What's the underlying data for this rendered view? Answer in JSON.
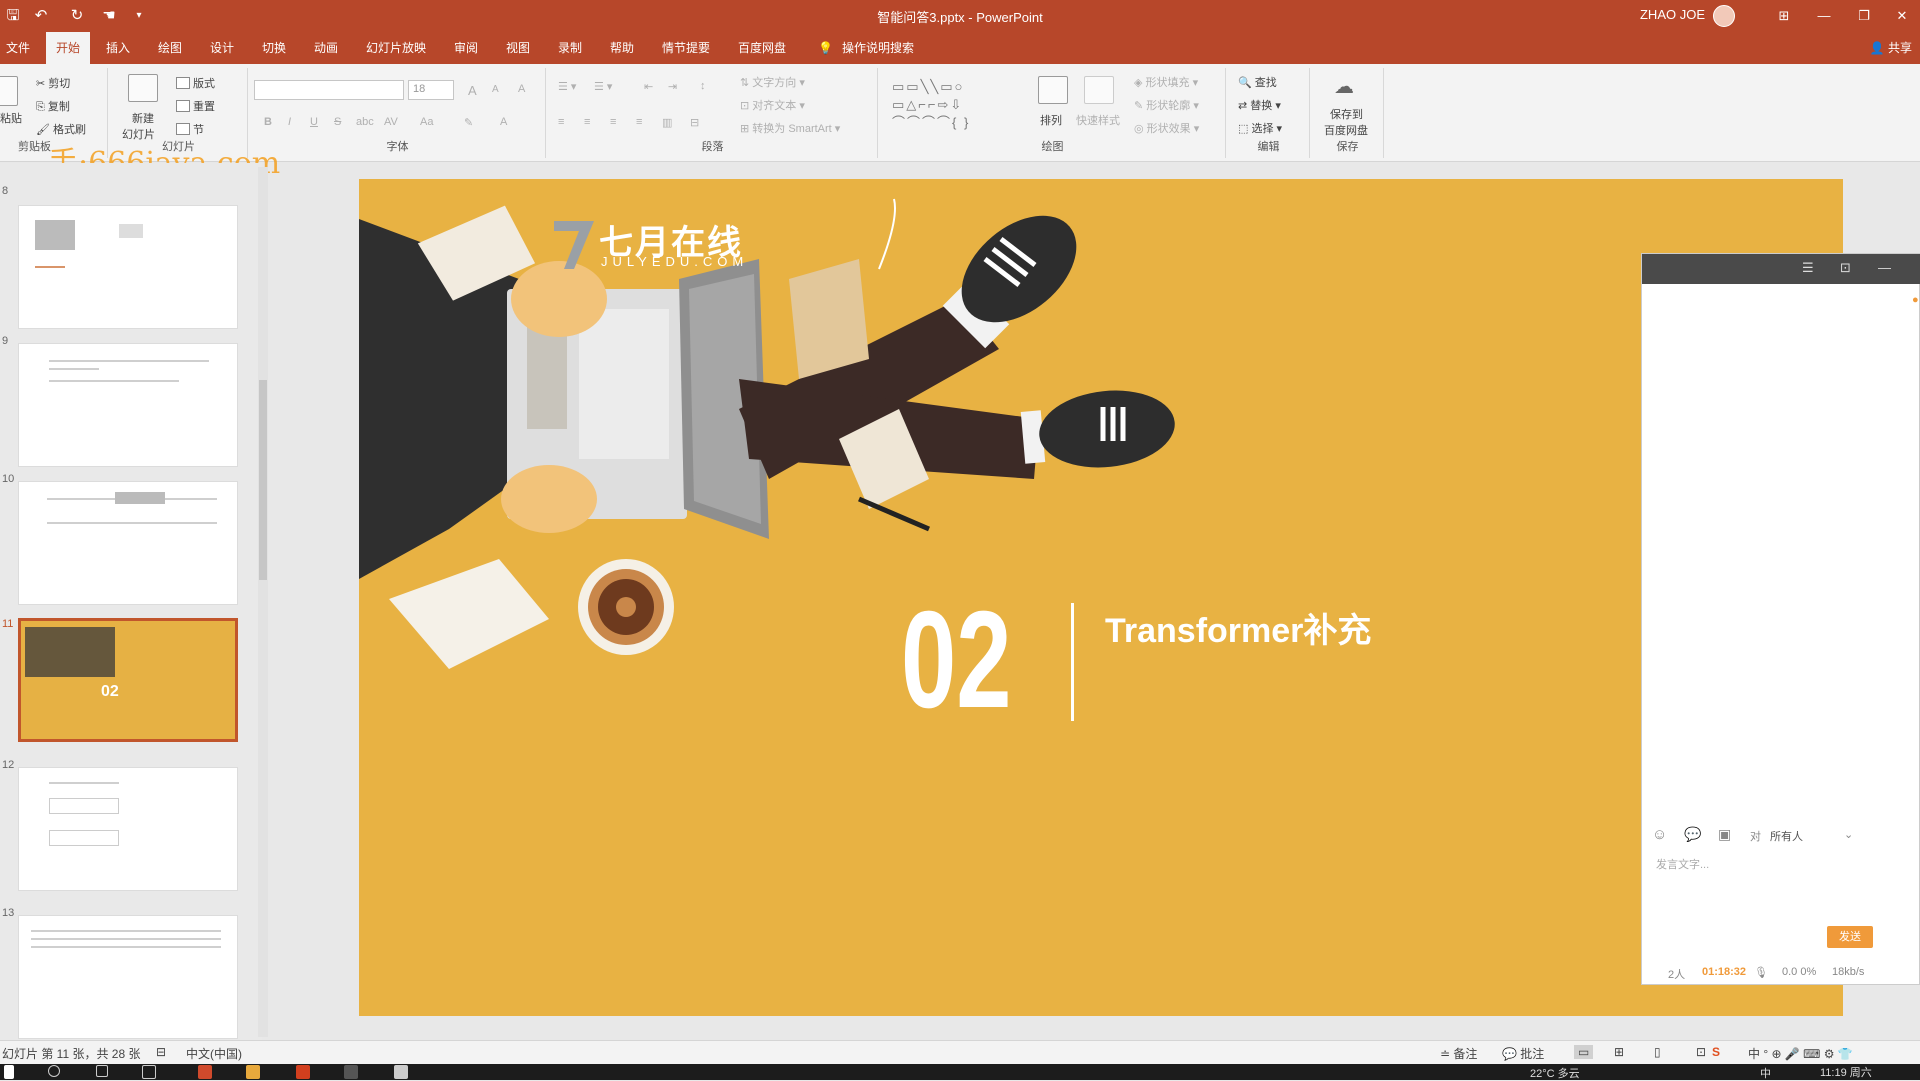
{
  "window": {
    "doc_title": "智能问答3.pptx - PowerPoint",
    "user_name": "ZHAO JOE",
    "minimize": "—",
    "restore": "❐",
    "close": "✕",
    "ribbon_display": "⊞"
  },
  "quick_access": {
    "save": "🖫",
    "undo": "↶",
    "redo": "↻",
    "touch": "☚",
    "customize": "▾"
  },
  "tabs": [
    "文件",
    "开始",
    "插入",
    "绘图",
    "设计",
    "切换",
    "动画",
    "幻灯片放映",
    "审阅",
    "视图",
    "录制",
    "帮助",
    "情节提要",
    "百度网盘"
  ],
  "active_tab": "开始",
  "tell_me": "操作说明搜索",
  "share": "共享",
  "ribbon": {
    "clipboard": {
      "paste": "粘贴",
      "cut": "剪切",
      "copy": "复制",
      "format_painter": "格式刷",
      "label": "剪贴板"
    },
    "slides": {
      "new_slide": "新建",
      "new_slide2": "幻灯片",
      "layout": "版式",
      "reset": "重置",
      "section": "节",
      "label": "幻灯片"
    },
    "font": {
      "size": "18",
      "bold": "B",
      "italic": "I",
      "underline": "U",
      "strike": "S",
      "shadow": "abc",
      "spacing": "AV",
      "case": "Aa",
      "color": "A",
      "grow": "A",
      "shrink": "A",
      "clear": "A",
      "label": "字体"
    },
    "paragraph": {
      "text_direction": "文字方向",
      "align_text": "对齐文本",
      "smartart": "转换为 SmartArt",
      "label": "段落"
    },
    "drawing": {
      "arrange": "排列",
      "quick_styles": "快速样式",
      "shape_fill": "形状填充",
      "shape_outline": "形状轮廓",
      "shape_effects": "形状效果",
      "label": "绘图"
    },
    "editing": {
      "find": "查找",
      "replace": "替换",
      "select": "选择",
      "label": "编辑"
    },
    "save": {
      "save_to": "保存到",
      "baidu": "百度网盘",
      "label": "保存"
    }
  },
  "watermark": "手:666java.com",
  "slide_panel": {
    "numbers": [
      "8",
      "9",
      "10",
      "11",
      "12",
      "13"
    ],
    "selected_index": 3
  },
  "slide": {
    "logo_cn": "七月在线",
    "logo_en": "JULYEDU.COM",
    "number": "02",
    "title": "Transformer补充",
    "background": "#e8b243"
  },
  "chat": {
    "header_icons": [
      "☰",
      "⊡",
      "—"
    ],
    "recipient": "所有人",
    "placeholder": "发言文字...",
    "send": "发送",
    "people": "2人",
    "timer": "01:18:32",
    "stats": "0.0 0%",
    "speed": "18kb/s"
  },
  "status": {
    "slide_info": "幻灯片 第 11 张，共 28 张",
    "language": "中文(中国)",
    "notes": "备注",
    "comments": "批注"
  },
  "taskbar": {
    "time": "11:19 周六",
    "weather": "22°C 多云",
    "ime": "中"
  }
}
